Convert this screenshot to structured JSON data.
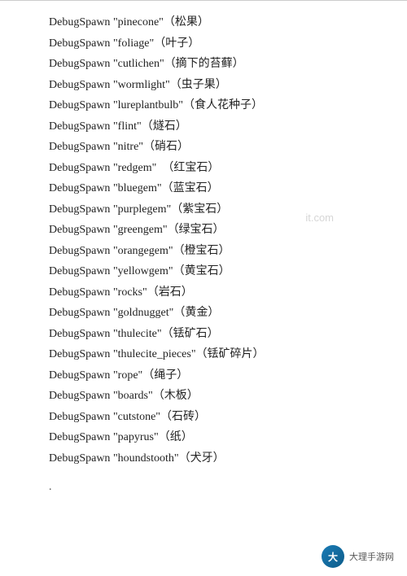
{
  "divider": true,
  "watermark": "it.com",
  "entries": [
    {
      "cmd": "DebugSpawn",
      "name": "\"pinecone\"",
      "cn": "（松果）"
    },
    {
      "cmd": "DebugSpawn",
      "name": "\"foliage\"",
      "cn": "（叶子）"
    },
    {
      "cmd": "DebugSpawn",
      "name": "\"cutlichen\"",
      "cn": "（摘下的苔藓）"
    },
    {
      "cmd": "DebugSpawn",
      "name": "\"wormlight\"",
      "cn": "（虫子果）"
    },
    {
      "cmd": "DebugSpawn",
      "name": "\"lureplantbulb\"",
      "cn": "（食人花种子）"
    },
    {
      "cmd": "DebugSpawn",
      "name": "\"flint\"",
      "cn": "（燧石）"
    },
    {
      "cmd": "DebugSpawn",
      "name": "\"nitre\"",
      "cn": "（硝石）"
    },
    {
      "cmd": "DebugSpawn",
      "name": "\"redgem\"",
      "cn": "　（红宝石）"
    },
    {
      "cmd": "DebugSpawn",
      "name": "\"bluegem\"",
      "cn": "（蓝宝石）"
    },
    {
      "cmd": "DebugSpawn",
      "name": "\"purplegem\"",
      "cn": "（紫宝石）"
    },
    {
      "cmd": "DebugSpawn",
      "name": "\"greengem\"",
      "cn": "（绿宝石）"
    },
    {
      "cmd": "DebugSpawn",
      "name": "\"orangegem\"",
      "cn": "（橙宝石）"
    },
    {
      "cmd": "DebugSpawn",
      "name": "\"yellowgem\"",
      "cn": "（黄宝石）"
    },
    {
      "cmd": "DebugSpawn",
      "name": "\"rocks\"",
      "cn": "（岩石）"
    },
    {
      "cmd": "DebugSpawn",
      "name": "\"goldnugget\"",
      "cn": "（黄金）"
    },
    {
      "cmd": "DebugSpawn",
      "name": "\"thulecite\"",
      "cn": "（铥矿石）"
    },
    {
      "cmd": "DebugSpawn",
      "name": "\"thulecite_pieces\"",
      "cn": "（铥矿碎片）"
    },
    {
      "cmd": "DebugSpawn",
      "name": "\"rope\"",
      "cn": "（绳子）"
    },
    {
      "cmd": "DebugSpawn",
      "name": "\"boards\"",
      "cn": "（木板）"
    },
    {
      "cmd": "DebugSpawn",
      "name": "\"cutstone\"",
      "cn": "（石砖）"
    },
    {
      "cmd": "DebugSpawn",
      "name": "\"papyrus\"",
      "cn": "（纸）"
    },
    {
      "cmd": "DebugSpawn",
      "name": "\"houndstooth\"",
      "cn": "（犬牙）"
    }
  ],
  "bottom_dot": ".",
  "logo": {
    "icon_text": "大",
    "text": "大理手游网"
  }
}
